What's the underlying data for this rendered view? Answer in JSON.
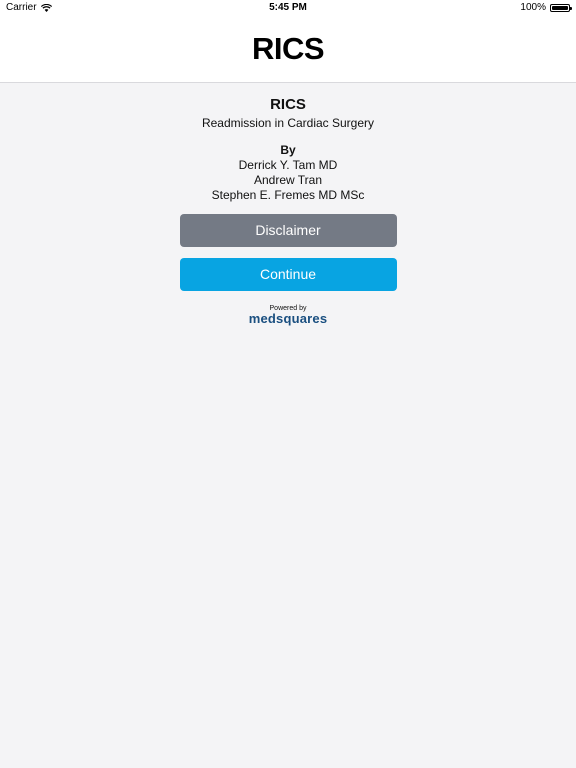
{
  "statusbar": {
    "carrier": "Carrier",
    "time": "5:45 PM",
    "battery": "100%",
    "battery_level": 1.0
  },
  "navbar": {
    "logo": "RICS"
  },
  "main": {
    "title": "RICS",
    "subtitle": "Readmission in Cardiac Surgery",
    "by_label": "By",
    "authors": [
      "Derrick Y. Tam MD",
      "Andrew Tran",
      "Stephen E. Fremes MD MSc"
    ]
  },
  "buttons": {
    "disclaimer": "Disclaimer",
    "continue": "Continue"
  },
  "footer": {
    "powered_by": "Powered by",
    "brand": "medsquares"
  },
  "colors": {
    "disclaimer_button": "#747a85",
    "continue_button": "#08a4e2",
    "brand": "#1a4f80"
  }
}
